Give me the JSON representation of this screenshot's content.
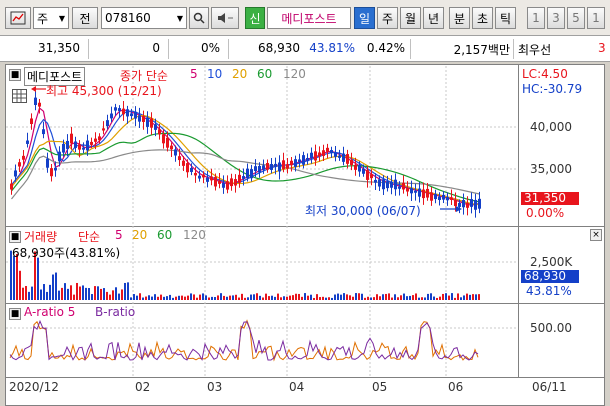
{
  "toolbar": {
    "market": "주",
    "period_btn": "전",
    "code": "078160",
    "new_badge": "신",
    "stock_name": "메디포스트",
    "periods": [
      "일",
      "주",
      "월",
      "년",
      "분",
      "초",
      "틱"
    ],
    "active_period": "일",
    "intervals": [
      "1",
      "3",
      "5",
      "1"
    ]
  },
  "quote": {
    "price": "31,350",
    "change": "0",
    "change_pct": "0%",
    "volume": "68,930",
    "volume_ratio": "43.81%",
    "turnover_pct": "0.42%",
    "amount": "2,157백만",
    "pref_label": "최우선",
    "pref_value": "3"
  },
  "price_panel": {
    "name_label": "메디포스트",
    "series_label": "종가 단순",
    "ma": [
      "5",
      "10",
      "20",
      "60",
      "120"
    ],
    "high_annotation": "최고 45,300 (12/21)",
    "low_annotation": "최저 30,000 (06/07)",
    "lc": "LC:4.50",
    "hc": "HC:-30.79",
    "y_ticks": [
      "40,000",
      "35,000"
    ],
    "current_price": "31,350",
    "current_pct": "0.00%"
  },
  "volume_panel": {
    "title": "거래량",
    "series_label": "단순",
    "ma": [
      "5",
      "20",
      "60",
      "120"
    ],
    "summary": "68,930주(43.81%)",
    "y_tick": "2,500K",
    "current": "68,930",
    "current_pct": "43.81%"
  },
  "ratio_panel": {
    "a_label": "A-ratio 5",
    "b_label": "B-ratio",
    "y_tick": "500.00"
  },
  "x_axis": {
    "labels": [
      "2020/12",
      "02",
      "03",
      "04",
      "05",
      "06"
    ],
    "right_label": "06/11"
  },
  "colors": {
    "up": "#e8141c",
    "down": "#1440c8",
    "ma5": "#d0006f",
    "ma10": "#2050d8",
    "ma20": "#e0a000",
    "ma60": "#1a9a30",
    "ma120": "#8a8a8a"
  }
}
